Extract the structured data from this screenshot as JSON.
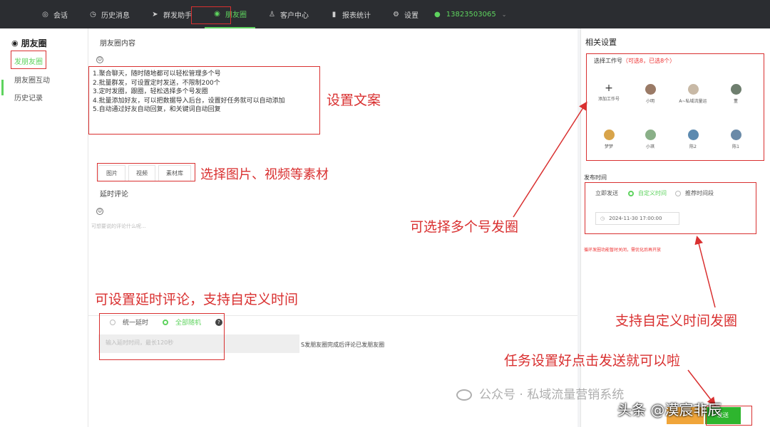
{
  "nav": {
    "items": [
      {
        "label": "会话",
        "icon": "chat-icon"
      },
      {
        "label": "历史消息",
        "icon": "clock-icon"
      },
      {
        "label": "群发助手",
        "icon": "send-icon"
      },
      {
        "label": "朋友圈",
        "icon": "moments-icon"
      },
      {
        "label": "客户中心",
        "icon": "user-icon"
      },
      {
        "label": "报表统计",
        "icon": "chart-icon"
      },
      {
        "label": "设置",
        "icon": "gear-icon"
      }
    ],
    "phone": "13823503065",
    "accent": "#5ed35e"
  },
  "sidebar": {
    "title": "朋友圈",
    "items": [
      "发朋友圈",
      "朋友圈互动",
      "历史记录"
    ]
  },
  "editor": {
    "content_label": "朋友圈内容",
    "content_lines": [
      "1.聚合聊天，随时随地都可以轻松管理多个号",
      "2.批量群发，可设置定时发送，不限制200个",
      "3.定时发圈，跟圈，轻松选择多个号发圈",
      "4.批量添加好友，可以把数据导入后台，设置好任务就可以自动添加",
      "5.自动通过好友自动回复，和关键词自动回复"
    ],
    "media_buttons": [
      "图片",
      "视频",
      "素材库"
    ],
    "delay_label": "延时评论",
    "comment_placeholder": "可想要说的评论什么呢...",
    "delay_modes": [
      "统一延时",
      "全部随机"
    ],
    "delay_input_placeholder": "输入延时时间，最长120秒",
    "delay_note": "S发朋友圈完成后评论已发朋友圈"
  },
  "settings": {
    "title": "相关设置",
    "select_label": "选择工作号",
    "select_hint": "（可选8，已选8个）",
    "accounts": [
      {
        "name": "添加工作号",
        "add": true
      },
      {
        "name": "小明",
        "color": "#9a7a66"
      },
      {
        "name": "A~私域流量运",
        "color": "#c8b9a6"
      },
      {
        "name": "董",
        "color": "#6e7e6e"
      },
      {
        "name": "梦梦",
        "color": "#d8a44a"
      },
      {
        "name": "小琪",
        "color": "#8ab088"
      },
      {
        "name": "陈2",
        "color": "#5c8ab0"
      },
      {
        "name": "陈1",
        "color": "#6a8aa8"
      }
    ],
    "publish_label": "发布时间",
    "publish_modes": [
      "立即发送",
      "自定义时间",
      "推荐时间段"
    ],
    "datetime": "2024-11-30 17:00:00",
    "warning": "循环发圈功能暂时关闭，需优化后再开放",
    "send_label": "发送"
  },
  "annotations": {
    "copy": "设置文案",
    "media": "选择图片、视频等素材",
    "multi": "可选择多个号发圈",
    "delay": "可设置延时评论，支持自定义时间",
    "custom_time": "支持自定义时间发圈",
    "send_tip": "任务设置好点击发送就可以啦"
  },
  "watermarks": {
    "wechat": "公众号 · 私域流量营销系统",
    "toutiao": "头条 @漠宸非辰"
  }
}
